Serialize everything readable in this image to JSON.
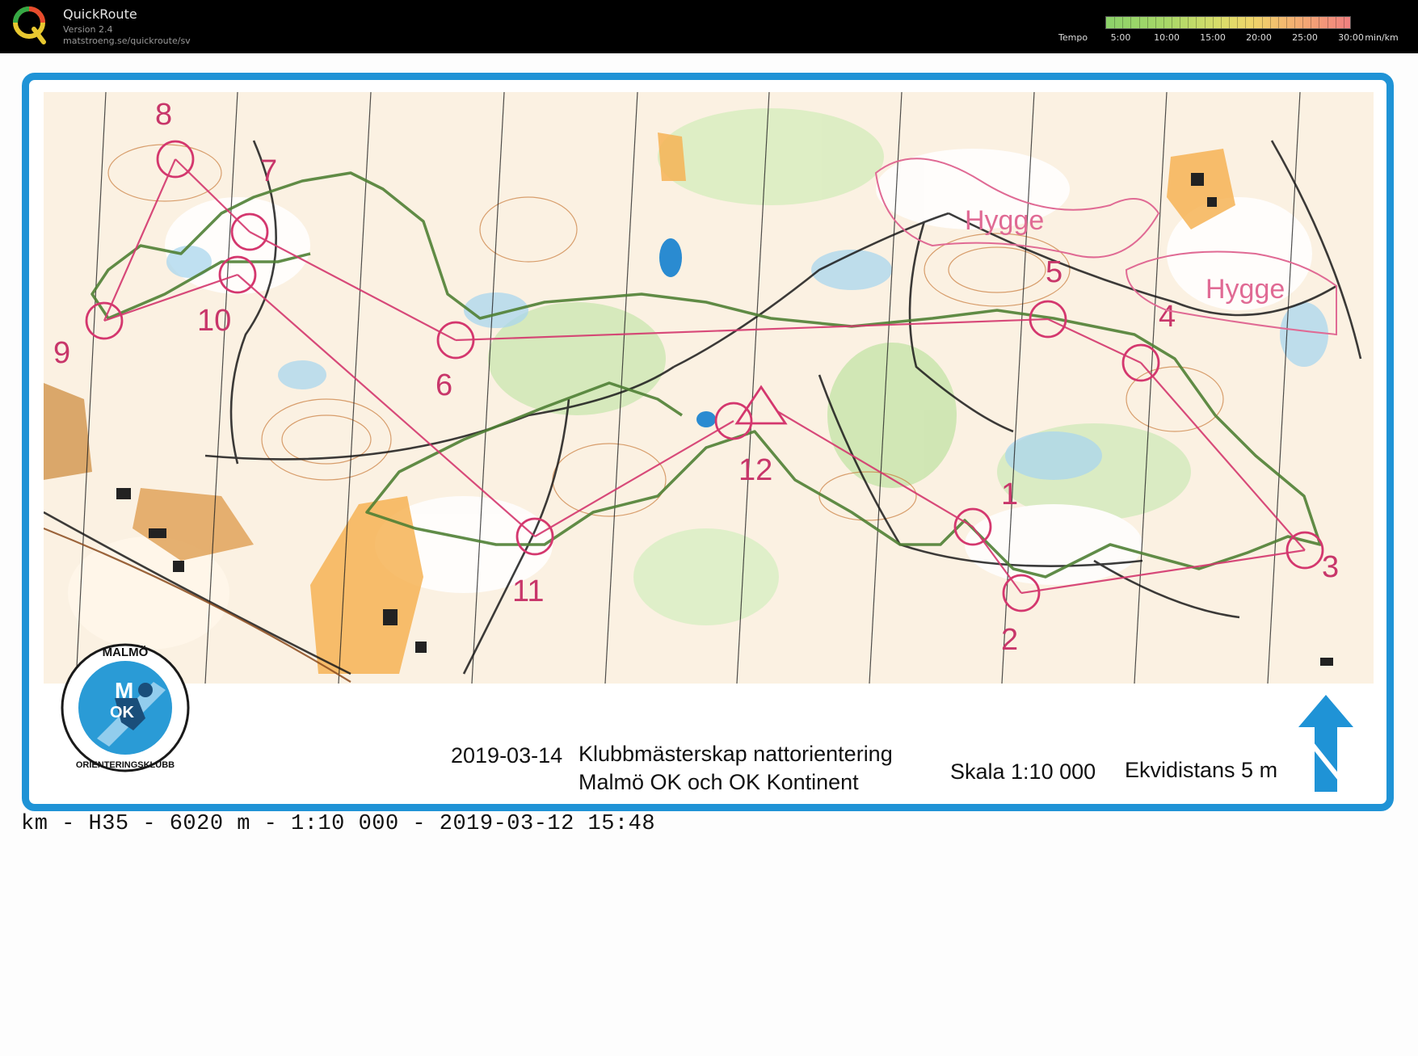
{
  "app": {
    "title": "QuickRoute",
    "version": "Version 2.4",
    "url": "matstroeng.se/quickroute/sv",
    "logo_icon": "quickroute-q-icon"
  },
  "tempo": {
    "label": "Tempo",
    "ticks": [
      "5:00",
      "10:00",
      "15:00",
      "20:00",
      "25:00",
      "30:00"
    ],
    "unit": "min/km"
  },
  "map": {
    "controls": [
      {
        "label": "1"
      },
      {
        "label": "2"
      },
      {
        "label": "3"
      },
      {
        "label": "4"
      },
      {
        "label": "5"
      },
      {
        "label": "6"
      },
      {
        "label": "7"
      },
      {
        "label": "8"
      },
      {
        "label": "9"
      },
      {
        "label": "10"
      },
      {
        "label": "11"
      },
      {
        "label": "12"
      }
    ],
    "area_labels": [
      "Hygge",
      "Hygge"
    ],
    "colors": {
      "course": "#d4376e",
      "route": "#4f7f34",
      "frame": "#1f93d6"
    }
  },
  "caption": {
    "date": "2019-03-14",
    "title": "Klubbmästerskap nattorientering",
    "clubs": "Malmö OK och OK Kontinent",
    "scale": "Skala 1:10 000",
    "equidistance": "Ekvidistans 5 m"
  },
  "club_logo": {
    "top_text": "MALMÖ",
    "bottom_text": "ORIENTERINGSKLUBB",
    "letters_top": "M",
    "letters_bottom": "OK"
  },
  "route_info": "km - H35 - 6020 m - 1:10 000 - 2019-03-12 15:48"
}
